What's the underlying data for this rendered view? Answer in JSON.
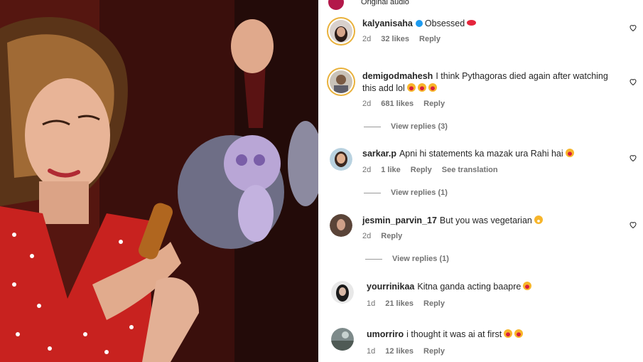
{
  "audio": {
    "label": "Original audio"
  },
  "colors": {
    "accent_ring": "#e9b13b",
    "verified": "#1d9bf0",
    "meta_text": "#737373"
  },
  "comments": [
    {
      "username": "kalyanisaha",
      "verified": true,
      "text": "Obsessed",
      "emojis": [
        "lips"
      ],
      "age": "2d",
      "likes": "32 likes",
      "reply": "Reply"
    },
    {
      "username": "demigodmahesh",
      "text": "I think Pythagoras died again after watching",
      "text_line2": "this add lol",
      "emojis": [
        "lol",
        "lol",
        "lol"
      ],
      "age": "2d",
      "likes": "681 likes",
      "reply": "Reply",
      "view_replies": "View replies (3)"
    },
    {
      "username": "sarkar.p",
      "text": "Apni hi statements ka mazak ura Rahi hai",
      "emojis": [
        "lol"
      ],
      "age": "2d",
      "likes": "1 like",
      "reply": "Reply",
      "translate": "See translation",
      "view_replies": "View replies (1)"
    },
    {
      "username": "jesmin_parvin_17",
      "text": "But you was vegetarian",
      "emojis": [
        "grin"
      ],
      "age": "2d",
      "reply": "Reply",
      "view_replies": "View replies (1)"
    },
    {
      "username": "yourrinikaa",
      "text": "Kitna ganda acting baapre",
      "emojis": [
        "lol"
      ],
      "age": "1d",
      "likes": "21 likes",
      "reply": "Reply"
    },
    {
      "username": "umorriro",
      "text": "i thought it was ai at first",
      "emojis": [
        "lol",
        "lol"
      ],
      "age": "1d",
      "likes": "12 likes",
      "reply": "Reply"
    }
  ]
}
